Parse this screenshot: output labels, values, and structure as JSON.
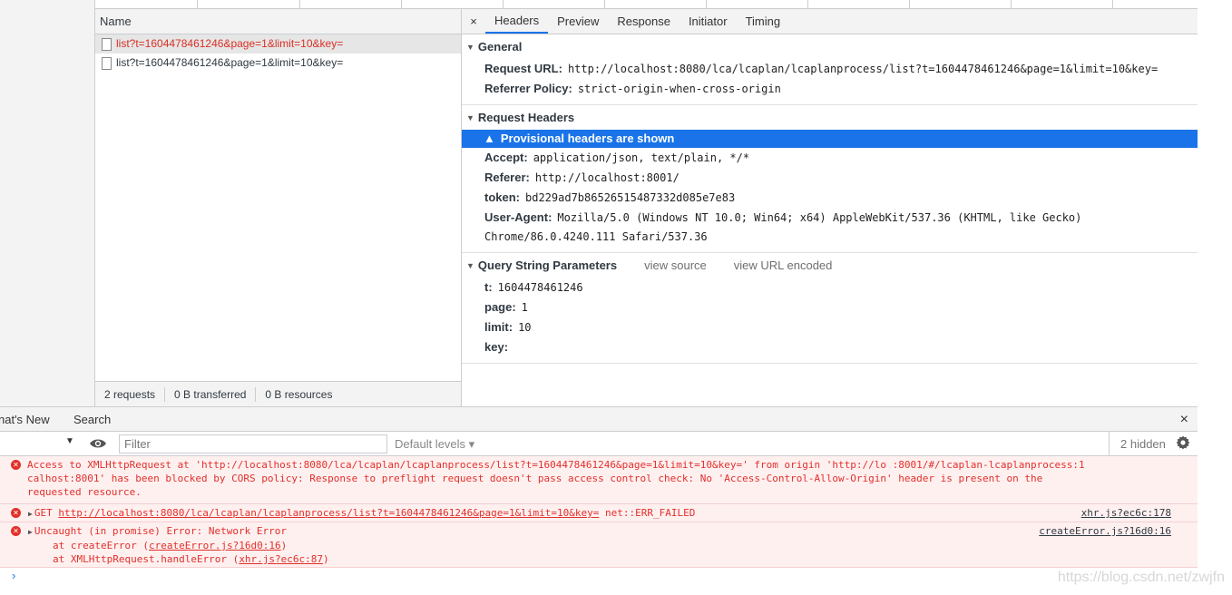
{
  "request_list": {
    "column_header": "Name",
    "rows": [
      {
        "name": "list?t=1604478461246&page=1&limit=10&key=",
        "status": "error"
      },
      {
        "name": "list?t=1604478461246&page=1&limit=10&key=",
        "status": "ok"
      }
    ],
    "summary": [
      "2 requests",
      "0 B transferred",
      "0 B resources"
    ]
  },
  "details": {
    "close_glyph": "×",
    "tabs": [
      "Headers",
      "Preview",
      "Response",
      "Initiator",
      "Timing"
    ],
    "active_tab": "Headers",
    "general": {
      "title": "General",
      "rows": [
        {
          "key": "Request URL:",
          "value": "http://localhost:8080/lca/lcaplan/lcaplanprocess/list?t=1604478461246&page=1&limit=10&key="
        },
        {
          "key": "Referrer Policy:",
          "value": "strict-origin-when-cross-origin"
        }
      ]
    },
    "request_headers": {
      "title": "Request Headers",
      "provisional_notice": "Provisional headers are shown",
      "rows": [
        {
          "key": "Accept:",
          "value": "application/json, text/plain, */*"
        },
        {
          "key": "Referer:",
          "value": "http://localhost:8001/"
        },
        {
          "key": "token:",
          "value": "bd229ad7b86526515487332d085e7e83"
        },
        {
          "key": "User-Agent:",
          "value": "Mozilla/5.0 (Windows NT 10.0; Win64; x64) AppleWebKit/537.36 (KHTML, like Gecko) Chrome/86.0.4240.111 Safari/537.36"
        }
      ]
    },
    "query_string": {
      "title": "Query String Parameters",
      "view_source": "view source",
      "view_url_encoded": "view URL encoded",
      "rows": [
        {
          "key": "t:",
          "value": "1604478461246"
        },
        {
          "key": "page:",
          "value": "1"
        },
        {
          "key": "limit:",
          "value": "10"
        },
        {
          "key": "key:",
          "value": ""
        }
      ]
    }
  },
  "drawer": {
    "tabs": [
      "hat's New",
      "Search"
    ],
    "close_glyph": "×",
    "filter_placeholder": "Filter",
    "levels": "Default levels ▾",
    "hidden_count": "2 hidden"
  },
  "console": {
    "messages": [
      {
        "lines": [
          "Access to XMLHttpRequest at 'http://localhost:8080/lca/lcaplan/lcaplanprocess/list?t=1604478461246&page=1&limit=10&key=' from origin 'http://lo  :8001/#/lcaplan-lcaplanprocess:1",
          "calhost:8001' has been blocked by CORS policy: Response to preflight request doesn't pass access control check: No 'Access-Control-Allow-Origin' header is present on the",
          "requested resource."
        ]
      },
      {
        "method": "GET",
        "url": "http://localhost:8080/lca/lcaplan/lcaplanprocess/list?t=1604478461246&page=1&limit=10&key=",
        "error": "net::ERR_FAILED",
        "source": "xhr.js?ec6c:178"
      },
      {
        "title": "Uncaught (in promise) Error: Network Error",
        "source": "createError.js?16d0:16",
        "stack": [
          {
            "prefix": "at createError (",
            "link": "createError.js?16d0:16",
            "suffix": ")"
          },
          {
            "prefix": "at XMLHttpRequest.handleError (",
            "link": "xhr.js?ec6c:87",
            "suffix": ")"
          }
        ]
      }
    ],
    "prompt": "›"
  },
  "watermark": "https://blog.csdn.net/zwjfn",
  "colors": {
    "accent": "#1a73e8",
    "error": "#e1302a",
    "error_bg": "#fff0f0"
  }
}
